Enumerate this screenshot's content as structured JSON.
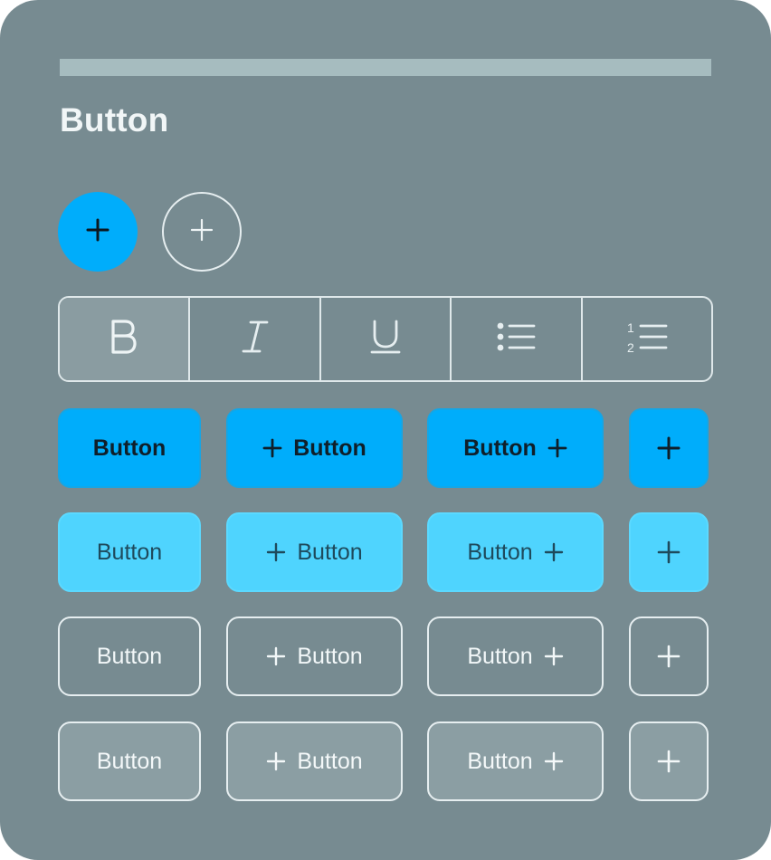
{
  "section": {
    "title": "Button"
  },
  "buttons": {
    "label": "Button"
  },
  "icons": {
    "plus": "plus-icon",
    "bold": "bold-icon",
    "italic": "italic-icon",
    "underline": "underline-icon",
    "bullet_list": "bullet-list-icon",
    "numbered_list": "numbered-list-icon"
  },
  "format_toolbar": {
    "active": "bold",
    "numbered_digits": [
      "1",
      "2"
    ]
  },
  "colors": {
    "background": "#778b91",
    "primary": "#00adfb",
    "light": "#4fd4fe",
    "muted": "#8b9ea3",
    "outline": "#e6eef0"
  }
}
